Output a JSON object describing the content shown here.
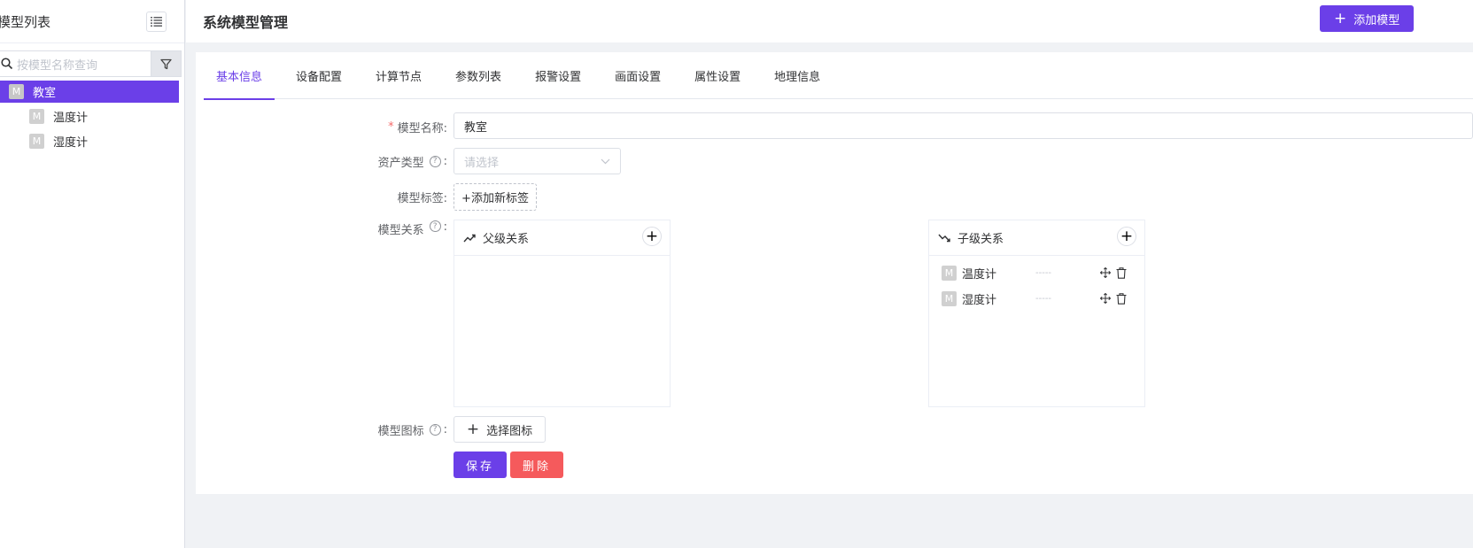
{
  "sidebar": {
    "title": "模型列表",
    "search_placeholder": "按模型名称查询",
    "tree": [
      {
        "badge": "M",
        "label": "教室"
      },
      {
        "badge": "M",
        "label": "温度计"
      },
      {
        "badge": "M",
        "label": "湿度计"
      }
    ]
  },
  "header": {
    "title": "系统模型管理",
    "add_model_label": "添加模型"
  },
  "tabs": [
    "基本信息",
    "设备配置",
    "计算节点",
    "参数列表",
    "报警设置",
    "画面设置",
    "属性设置",
    "地理信息"
  ],
  "form": {
    "name_label": "模型名称:",
    "name_value": "教室",
    "asset_type_label": "资产类型",
    "asset_type_placeholder": "请选择",
    "tags_label": "模型标签:",
    "add_tag_label": "+添加新标签",
    "relation_label": "模型关系",
    "parent_relation_title": "父级关系",
    "child_relation_title": "子级关系",
    "children": [
      {
        "badge": "M",
        "label": "温度计",
        "dash": "-----"
      },
      {
        "badge": "M",
        "label": "湿度计",
        "dash": "-----"
      }
    ],
    "icon_label": "模型图标",
    "select_icon_label": "选择图标",
    "colon": ":",
    "save_label": "保存",
    "delete_label": "删除"
  },
  "colors": {
    "accent": "#6b3fe8",
    "danger": "#f55a5c"
  }
}
